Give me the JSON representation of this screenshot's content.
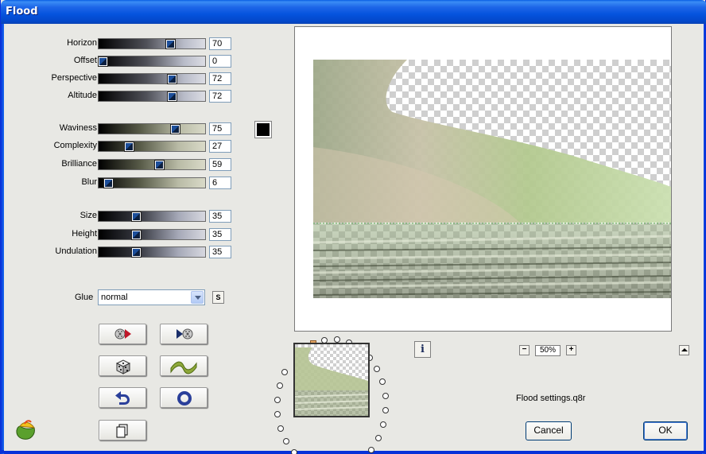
{
  "window": {
    "title": "Flood"
  },
  "params": [
    {
      "name": "horizon",
      "label": "Horizon",
      "value": "70",
      "pct": 0.7
    },
    {
      "name": "offset",
      "label": "Offset",
      "value": "0",
      "pct": 0.0
    },
    {
      "name": "perspective",
      "label": "Perspective",
      "value": "72",
      "pct": 0.72
    },
    {
      "name": "altitude",
      "label": "Altitude",
      "value": "72",
      "pct": 0.72
    },
    {
      "name": "waviness",
      "label": "Waviness",
      "value": "75",
      "pct": 0.75
    },
    {
      "name": "complexity",
      "label": "Complexity",
      "value": "27",
      "pct": 0.27
    },
    {
      "name": "brilliance",
      "label": "Brilliance",
      "value": "59",
      "pct": 0.59
    },
    {
      "name": "blur",
      "label": "Blur",
      "value": "6",
      "pct": 0.06
    },
    {
      "name": "size",
      "label": "Size",
      "value": "35",
      "pct": 0.35
    },
    {
      "name": "height",
      "label": "Height",
      "value": "35",
      "pct": 0.35
    },
    {
      "name": "undulation",
      "label": "Undulation",
      "value": "35",
      "pct": 0.35
    }
  ],
  "color_swatch": "#000000",
  "glue": {
    "label": "Glue",
    "value": "normal",
    "s_button": "S"
  },
  "zoom": {
    "value": "50%",
    "minus": "−",
    "plus": "+"
  },
  "status": {
    "filename": "Flood settings.q8r"
  },
  "buttons": {
    "cancel": "Cancel",
    "ok": "OK"
  },
  "icons": {
    "tool_1": "film-reel-play-icon",
    "tool_2": "play-film-reel-icon",
    "tool_3": "dice-icon",
    "tool_4": "wave-icon",
    "tool_5": "undo-arrow-icon",
    "tool_6": "ring-icon",
    "tool_7": "copy-pages-icon",
    "info": "info-icon",
    "logo": "filter-factory-logo-icon"
  }
}
